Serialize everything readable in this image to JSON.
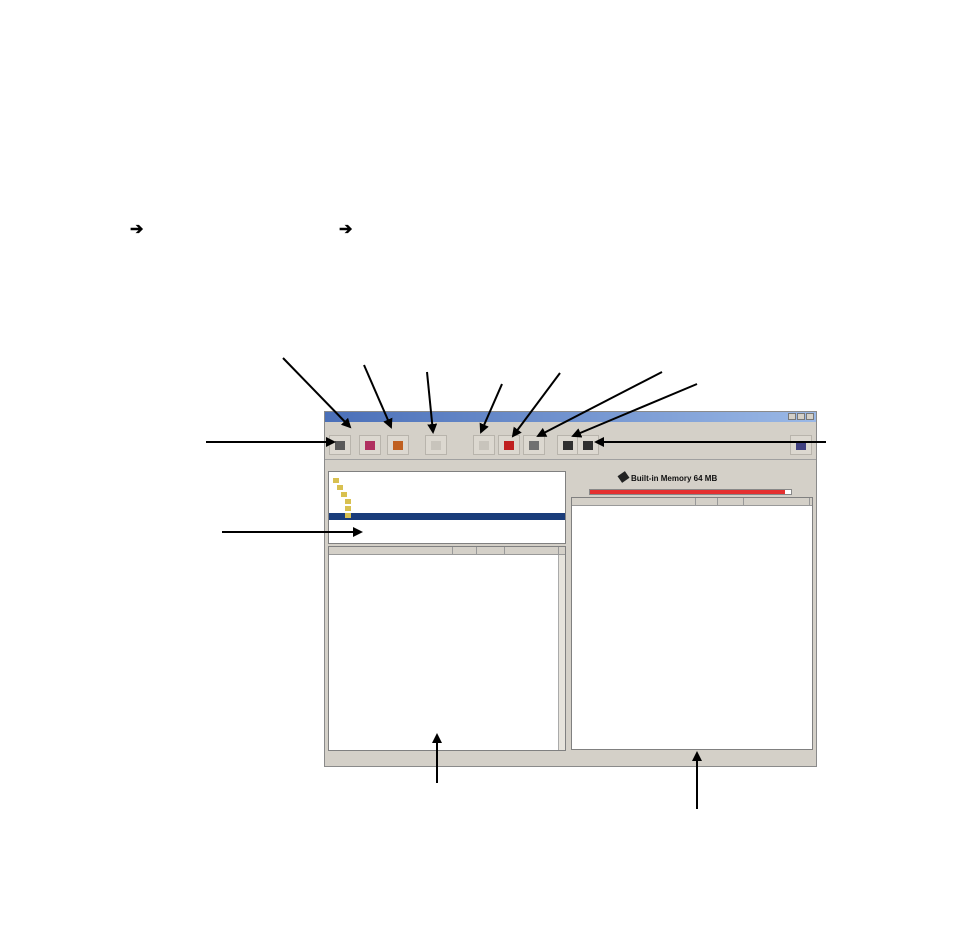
{
  "arrows_row": {
    "glyph_1": "➔",
    "glyph_2": "➔"
  },
  "window": {
    "title": "",
    "menu": [
      "",
      "",
      ""
    ],
    "toolbar_icons": [
      {
        "name": "view-toggle-icon",
        "color": "#5a5a5a"
      },
      {
        "name": "transfer-icon",
        "color": "#b03060"
      },
      {
        "name": "copy-icon",
        "color": "#c06020"
      },
      {
        "name": "disabled-button-icon",
        "color": "#c8c4bc"
      },
      {
        "name": "disabled-button-icon",
        "color": "#c8c4bc"
      },
      {
        "name": "delete-icon",
        "color": "#c02020"
      },
      {
        "name": "properties-icon",
        "color": "#707070"
      },
      {
        "name": "move-up-icon",
        "color": "#303030"
      },
      {
        "name": "move-down-icon",
        "color": "#303030"
      },
      {
        "name": "help-icon",
        "color": "#404080"
      }
    ],
    "tree_nodes": [
      "",
      "",
      "",
      "",
      "",
      ""
    ],
    "left_list": {
      "columns": [
        "",
        "",
        "",
        ""
      ],
      "rows": [
        [
          "",
          "",
          "",
          ""
        ],
        [
          "",
          "",
          "",
          ""
        ],
        [
          "",
          "",
          "",
          ""
        ],
        [
          "",
          "",
          "",
          ""
        ],
        [
          "",
          "",
          "",
          ""
        ],
        [
          "",
          "",
          "",
          ""
        ],
        [
          "",
          "",
          "",
          ""
        ],
        [
          "",
          "",
          "",
          ""
        ],
        [
          "",
          "",
          "",
          ""
        ],
        [
          "",
          "",
          "",
          ""
        ],
        [
          "",
          "",
          "",
          ""
        ],
        [
          "",
          "",
          "",
          ""
        ],
        [
          "",
          "",
          "",
          ""
        ],
        [
          "",
          "",
          "",
          ""
        ],
        [
          "",
          "",
          "",
          ""
        ],
        [
          "",
          "",
          "",
          ""
        ],
        [
          "",
          "",
          "",
          ""
        ],
        [
          "",
          "",
          "",
          ""
        ],
        [
          "",
          "",
          "",
          ""
        ],
        [
          "",
          "",
          "",
          ""
        ],
        [
          "",
          "",
          "",
          ""
        ],
        [
          "",
          "",
          "",
          ""
        ],
        [
          "",
          "",
          "",
          ""
        ],
        [
          "",
          "",
          "",
          ""
        ],
        [
          "",
          "",
          "",
          ""
        ],
        [
          "",
          "",
          "",
          ""
        ]
      ]
    },
    "memory": {
      "label": "Built-in Memory  64 MB",
      "used_fraction": 0.97,
      "fill_color": "#e43030"
    },
    "right_list": {
      "columns": [
        "",
        "",
        "",
        ""
      ],
      "rows": [
        [
          "",
          "",
          "",
          ""
        ],
        [
          "",
          "",
          "",
          ""
        ],
        [
          "",
          "",
          "",
          ""
        ],
        [
          "",
          "",
          "",
          ""
        ],
        [
          "",
          "",
          "",
          ""
        ],
        [
          "",
          "",
          "",
          ""
        ],
        [
          "",
          "",
          "",
          ""
        ],
        [
          "",
          "",
          "",
          ""
        ],
        [
          "",
          "",
          "",
          ""
        ],
        [
          "",
          "",
          "",
          ""
        ],
        [
          "",
          "",
          "",
          ""
        ],
        [
          "",
          "",
          "",
          ""
        ],
        [
          "",
          "",
          "",
          ""
        ],
        [
          "",
          "",
          "",
          ""
        ],
        [
          "",
          "",
          "",
          ""
        ],
        [
          "",
          "",
          "",
          ""
        ],
        [
          "",
          "",
          "",
          ""
        ],
        [
          "",
          "",
          "",
          ""
        ]
      ]
    },
    "status_left": [
      "",
      ""
    ],
    "status_right": [
      "",
      ""
    ]
  }
}
